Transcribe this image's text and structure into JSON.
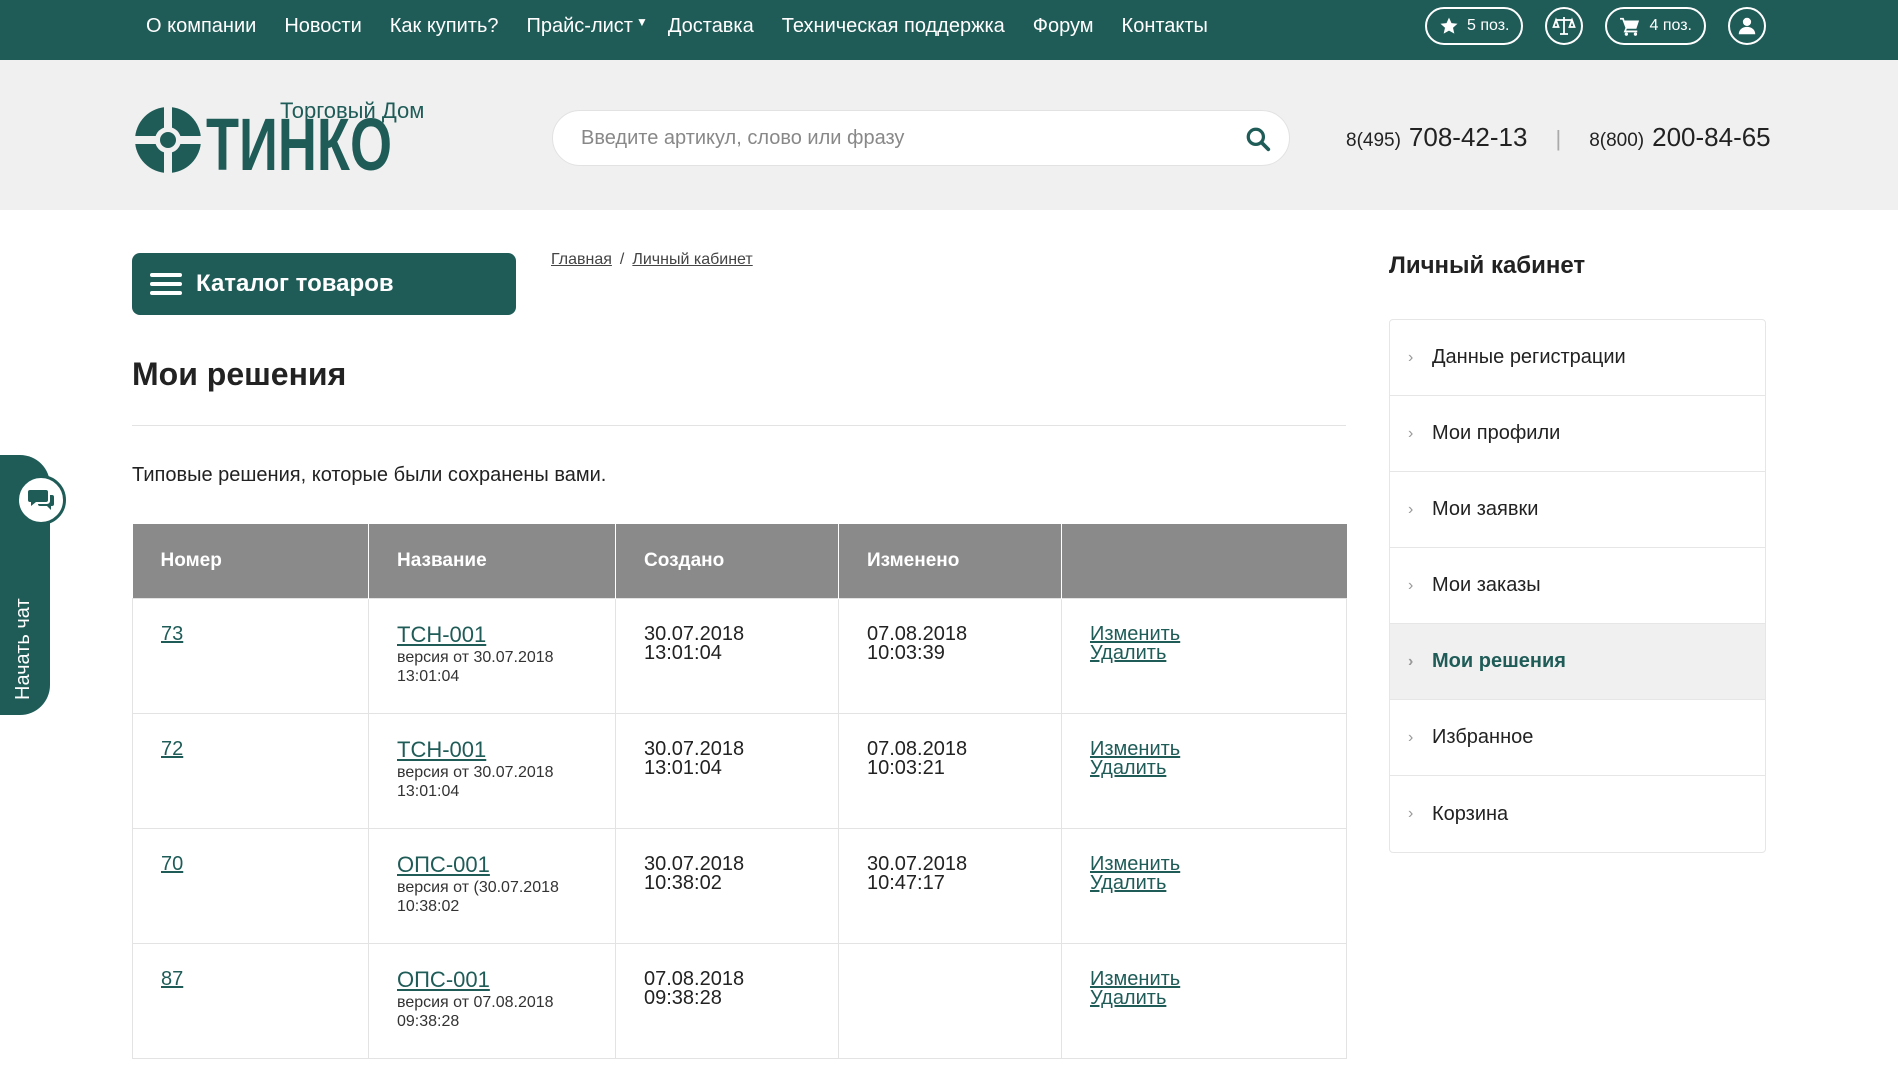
{
  "topnav": {
    "items": [
      "О компании",
      "Новости",
      "Как купить?",
      "Прайс-лист",
      "Доставка",
      "Техническая поддержка",
      "Форум",
      "Контакты"
    ],
    "favorites_label": "5 поз.",
    "cart_label": "4 поз.",
    "icons": [
      "star-icon",
      "scales-icon",
      "cart-icon",
      "user-icon"
    ]
  },
  "header": {
    "logo_subtitle": "Торговый Дом",
    "logo_name": "ТИНКО",
    "search_placeholder": "Введите артикул, слово или фразу",
    "phone1_code": "8(495)",
    "phone1_number": "708-42-13",
    "phone_separator": "|",
    "phone2_code": "8(800)",
    "phone2_number": "200-84-65"
  },
  "catalog": {
    "label": "Каталог товаров"
  },
  "breadcrumb": {
    "home": "Главная",
    "separator": "/",
    "current": "Личный кабинет"
  },
  "page": {
    "title": "Мои решения",
    "intro": "Типовые решения, которые были сохранены вами."
  },
  "table": {
    "headers": [
      "Номер",
      "Название",
      "Создано",
      "Изменено",
      ""
    ],
    "rows": [
      {
        "number": "73",
        "name": "ТСН-001",
        "version_line1": "версия от 30.07.2018",
        "version_line2": "13:01:04",
        "created_date": "30.07.2018",
        "created_time": "13:01:04",
        "modified_date": "07.08.2018",
        "modified_time": "10:03:39",
        "edit": "Изменить",
        "delete": "Удалить"
      },
      {
        "number": "72",
        "name": "ТСН-001",
        "version_line1": "версия от 30.07.2018",
        "version_line2": "13:01:04",
        "created_date": "30.07.2018",
        "created_time": "13:01:04",
        "modified_date": "07.08.2018",
        "modified_time": "10:03:21",
        "edit": "Изменить",
        "delete": "Удалить"
      },
      {
        "number": "70",
        "name": "ОПС-001",
        "version_line1": "версия от (30.07.2018",
        "version_line2": "10:38:02",
        "created_date": "30.07.2018",
        "created_time": "10:38:02",
        "modified_date": "30.07.2018",
        "modified_time": "10:47:17",
        "edit": "Изменить",
        "delete": "Удалить"
      },
      {
        "number": "87",
        "name": "ОПС-001",
        "version_line1": "версия от 07.08.2018",
        "version_line2": "09:38:28",
        "created_date": "07.08.2018",
        "created_time": "09:38:28",
        "modified_date": "",
        "modified_time": "",
        "edit": "Изменить",
        "delete": "Удалить"
      }
    ]
  },
  "sidebar": {
    "title": "Личный кабинет",
    "items": [
      {
        "label": "Данные регистрации",
        "active": false
      },
      {
        "label": "Мои профили",
        "active": false
      },
      {
        "label": "Мои заявки",
        "active": false
      },
      {
        "label": "Мои заказы",
        "active": false
      },
      {
        "label": "Мои решения",
        "active": true
      },
      {
        "label": "Избранное",
        "active": false
      },
      {
        "label": "Корзина",
        "active": false
      }
    ]
  },
  "chat": {
    "label": "Начать чат"
  },
  "colors": {
    "brand": "#1f5c58",
    "header_bg": "#f0f0f0",
    "table_header": "#8a8a8a",
    "link": "#1f5c58"
  }
}
